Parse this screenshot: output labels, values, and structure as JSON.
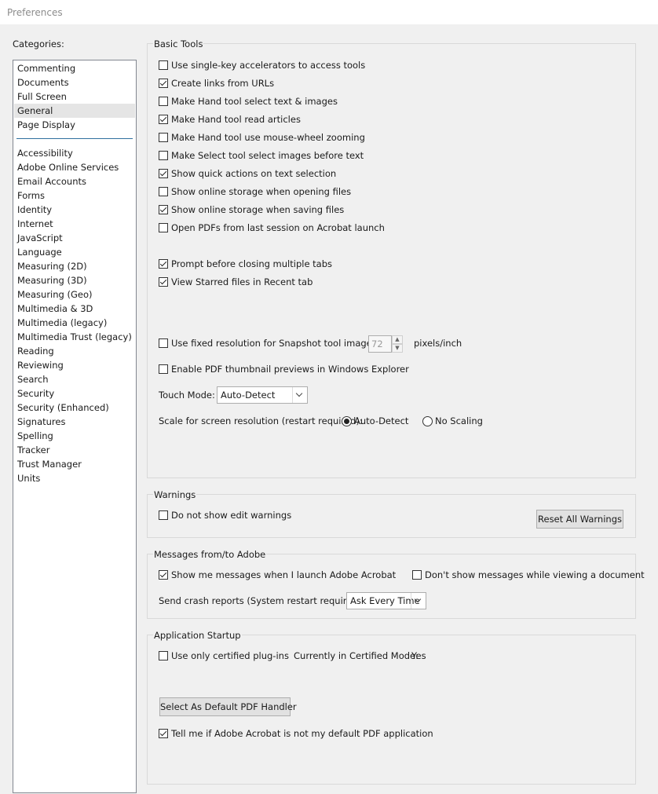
{
  "window": {
    "title": "Preferences"
  },
  "categories": {
    "label": "Categories:",
    "group1": [
      "Commenting",
      "Documents",
      "Full Screen",
      "General",
      "Page Display"
    ],
    "group2": [
      "Accessibility",
      "Adobe Online Services",
      "Email Accounts",
      "Forms",
      "Identity",
      "Internet",
      "JavaScript",
      "Language",
      "Measuring (2D)",
      "Measuring (3D)",
      "Measuring (Geo)",
      "Multimedia & 3D",
      "Multimedia (legacy)",
      "Multimedia Trust (legacy)",
      "Reading",
      "Reviewing",
      "Search",
      "Security",
      "Security (Enhanced)",
      "Signatures",
      "Spelling",
      "Tracker",
      "Trust Manager",
      "Units"
    ],
    "selected": "General"
  },
  "basic_tools": {
    "title": "Basic Tools",
    "options": [
      {
        "label": "Use single-key accelerators to access tools",
        "checked": false
      },
      {
        "label": "Create links from URLs",
        "checked": true
      },
      {
        "label": "Make Hand tool select text & images",
        "checked": false
      },
      {
        "label": "Make Hand tool read articles",
        "checked": true
      },
      {
        "label": "Make Hand tool use mouse-wheel zooming",
        "checked": false
      },
      {
        "label": "Make Select tool select images before text",
        "checked": false
      },
      {
        "label": "Show quick actions on text selection",
        "checked": true
      },
      {
        "label": "Show online storage when opening files",
        "checked": false
      },
      {
        "label": "Show online storage when saving files",
        "checked": true
      },
      {
        "label": "Open PDFs from last session on Acrobat launch",
        "checked": false
      },
      {
        "label": "Prompt before closing multiple tabs",
        "checked": true
      },
      {
        "label": "View Starred files in Recent tab",
        "checked": true
      }
    ],
    "snapshot": {
      "label": "Use fixed resolution for Snapshot tool images:",
      "checked": false,
      "value": "72",
      "unit": "pixels/inch"
    },
    "thumbnail": {
      "label": "Enable PDF thumbnail previews in Windows Explorer",
      "checked": false
    },
    "touch_mode": {
      "label": "Touch Mode:",
      "value": "Auto-Detect"
    },
    "scale": {
      "label": "Scale for screen resolution (restart required):",
      "options": [
        "Auto-Detect",
        "No Scaling"
      ],
      "selected": "Auto-Detect"
    }
  },
  "warnings": {
    "title": "Warnings",
    "option": {
      "label": "Do not show edit warnings",
      "checked": false
    },
    "reset_button": "Reset All Warnings"
  },
  "messages": {
    "title": "Messages from/to Adobe",
    "show_on_launch": {
      "label": "Show me messages when I launch Adobe Acrobat",
      "checked": true
    },
    "dont_show_viewing": {
      "label": "Don't show messages while viewing a document",
      "checked": false
    },
    "crash_reports": {
      "label": "Send crash reports (System restart required):",
      "value": "Ask Every Time"
    }
  },
  "startup": {
    "title": "Application Startup",
    "certified": {
      "label": "Use only certified plug-ins",
      "checked": false
    },
    "certified_mode_label": "Currently in Certified Mode:",
    "certified_mode_value": "Yes",
    "default_handler_button": "Select As Default PDF Handler",
    "tell_me": {
      "label": "Tell me if Adobe Acrobat is not my default PDF application",
      "checked": true
    }
  }
}
